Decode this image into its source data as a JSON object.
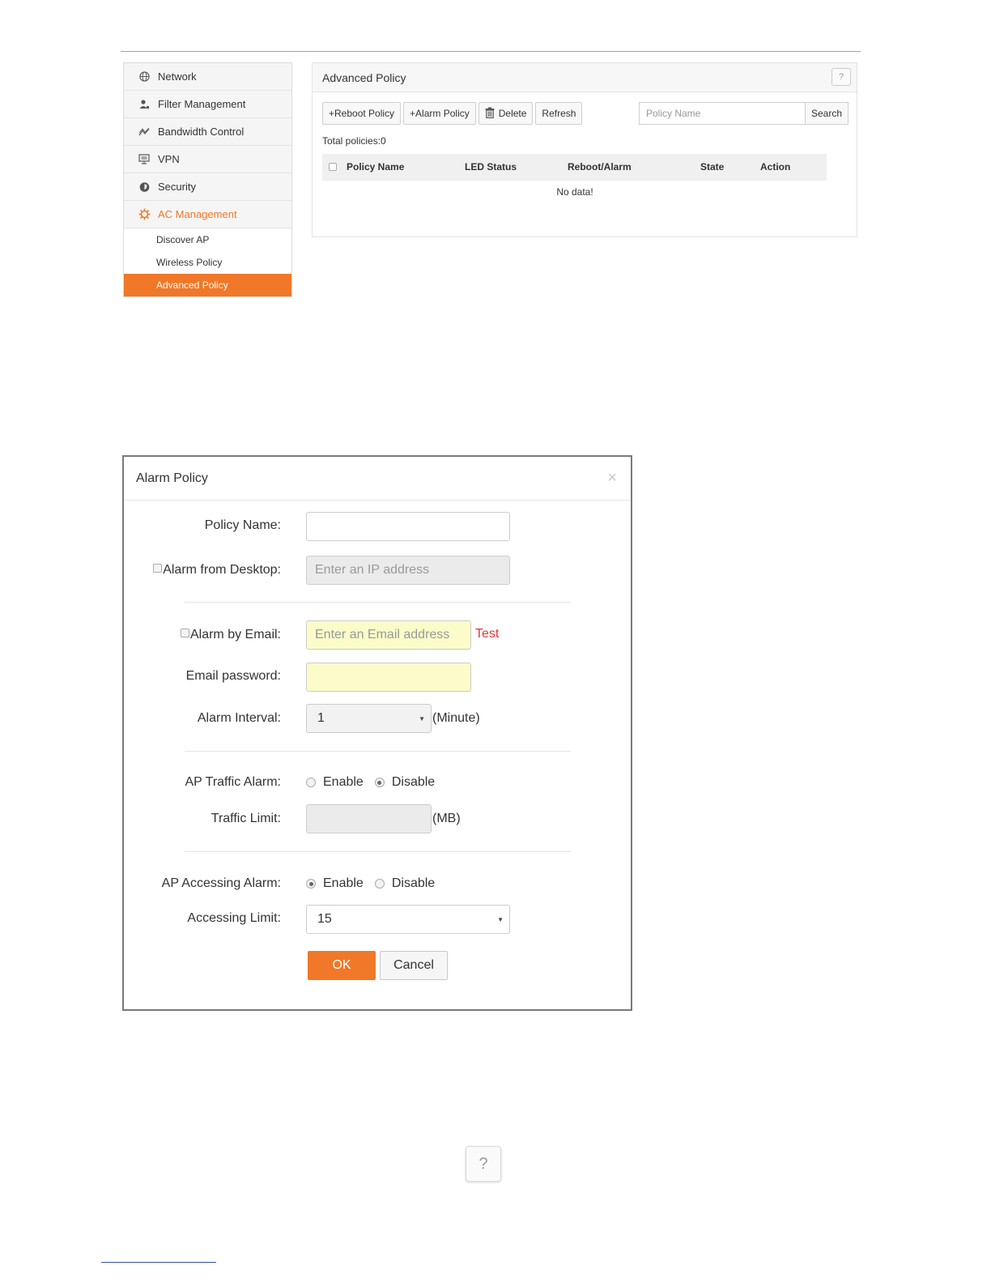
{
  "sidebar": {
    "items": [
      {
        "label": "Network",
        "icon": "globe-icon"
      },
      {
        "label": "Filter Management",
        "icon": "user-filter-icon"
      },
      {
        "label": "Bandwidth Control",
        "icon": "chart-line-icon"
      },
      {
        "label": "VPN",
        "icon": "monitor-icon"
      },
      {
        "label": "Security",
        "icon": "shield-icon"
      },
      {
        "label": "AC Management",
        "icon": "ac-gear-icon"
      }
    ],
    "subitems": [
      {
        "label": "Discover AP"
      },
      {
        "label": "Wireless Policy"
      },
      {
        "label": "Advanced Policy"
      }
    ]
  },
  "panel": {
    "title": "Advanced Policy",
    "help": "?",
    "toolbar": {
      "reboot": "+Reboot Policy",
      "alarm": "+Alarm Policy",
      "delete": "Delete",
      "refresh": "Refresh"
    },
    "search": {
      "placeholder": "Policy Name",
      "button": "Search"
    },
    "total": "Total policies:0",
    "columns": [
      "Policy Name",
      "LED Status",
      "Reboot/Alarm",
      "State",
      "Action"
    ],
    "empty": "No data!"
  },
  "dialog": {
    "title": "Alarm Policy",
    "close": "×",
    "policy_name_label": "Policy Name:",
    "desktop_label": "Alarm from Desktop:",
    "desktop_placeholder": "Enter an IP address",
    "email_label": "Alarm by Email:",
    "email_placeholder": "Enter an Email address",
    "test": "Test",
    "password_label": "Email password:",
    "interval_label": "Alarm Interval:",
    "interval_value": "1",
    "interval_unit": "(Minute)",
    "traffic_alarm_label": "AP Traffic Alarm:",
    "enable": "Enable",
    "disable": "Disable",
    "traffic_limit_label": "Traffic Limit:",
    "traffic_unit": "(MB)",
    "accessing_alarm_label": "AP Accessing Alarm:",
    "accessing_limit_label": "Accessing Limit:",
    "accessing_limit_value": "15",
    "ok": "OK",
    "cancel": "Cancel"
  },
  "help_button": "?",
  "colors": {
    "accent": "#f07828",
    "test_link": "#e53535",
    "email_field": "#fbfcc9"
  }
}
